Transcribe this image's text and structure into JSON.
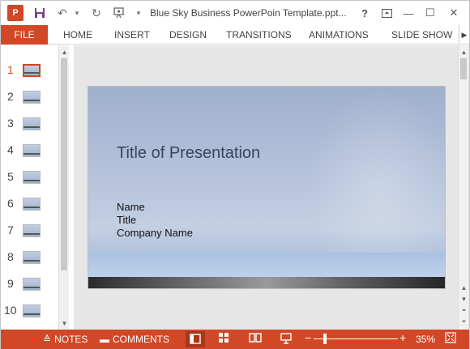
{
  "titlebar": {
    "app_logo": "P",
    "save_icon": "disk-icon",
    "undo_icon": "undo-icon",
    "redo_icon": "redo-icon",
    "present_icon": "present-icon",
    "dropdown_icon": "▾",
    "title": "Blue Sky Business PowerPoin Template.ppt...",
    "help": "?",
    "restore": "⊡",
    "minimize": "—",
    "maximize": "☐",
    "close": "✕"
  },
  "ribbon": {
    "file": "FILE",
    "tabs": [
      "HOME",
      "INSERT",
      "DESIGN",
      "TRANSITIONS",
      "ANIMATIONS",
      "SLIDE SHOW"
    ],
    "scroll_right": "▶"
  },
  "thumbnails": {
    "numbers": [
      "1",
      "2",
      "3",
      "4",
      "5",
      "6",
      "7",
      "8",
      "9",
      "10"
    ],
    "selected": 1
  },
  "slide": {
    "title": "Title of Presentation",
    "lines": [
      "Name",
      "Title",
      "Company Name"
    ]
  },
  "statusbar": {
    "notes": "NOTES",
    "comments": "COMMENTS",
    "zoom_minus": "−",
    "zoom_plus": "+",
    "zoom": "35%",
    "zoom_level": 0.35
  },
  "colors": {
    "accent": "#d24726",
    "slide_bg": "#b3c1da"
  }
}
